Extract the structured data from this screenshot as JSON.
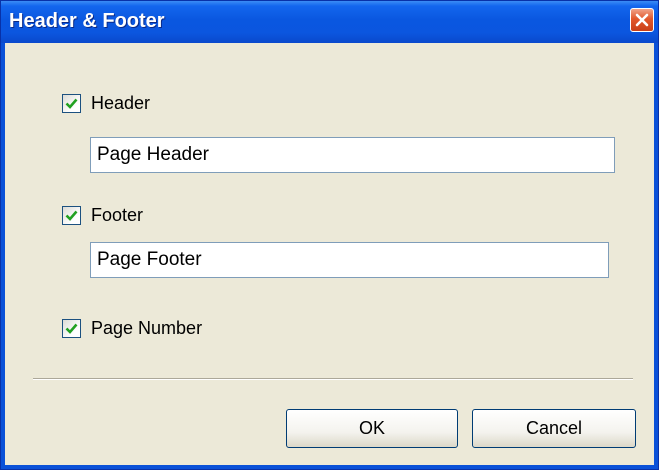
{
  "window": {
    "title": "Header & Footer",
    "close_icon": "close-icon"
  },
  "options": {
    "header": {
      "label": "Header",
      "checked": true,
      "value": "Page Header"
    },
    "footer": {
      "label": "Footer",
      "checked": true,
      "value": "Page Footer"
    },
    "page_number": {
      "label": "Page Number",
      "checked": true
    }
  },
  "buttons": {
    "ok_label": "OK",
    "cancel_label": "Cancel"
  },
  "colors": {
    "titlebar": "#0a57e0",
    "dialog_background": "#ece9d8",
    "checkmark": "#21a121",
    "close_button": "#e2572b"
  }
}
